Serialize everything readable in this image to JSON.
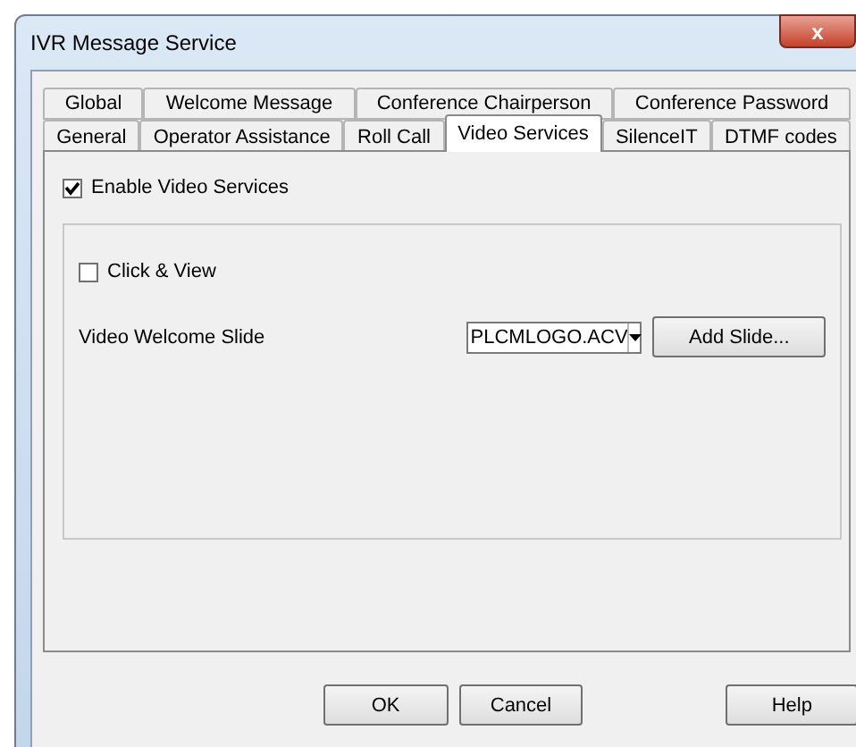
{
  "window": {
    "title": "IVR Message Service",
    "close": "x"
  },
  "tab_rows": [
    [
      {
        "label": "Global",
        "selected": false
      },
      {
        "label": "Welcome Message",
        "selected": false
      },
      {
        "label": "Conference Chairperson",
        "selected": false
      },
      {
        "label": "Conference Password",
        "selected": false
      }
    ],
    [
      {
        "label": "General",
        "selected": false
      },
      {
        "label": "Operator Assistance",
        "selected": false
      },
      {
        "label": "Roll Call",
        "selected": false
      },
      {
        "label": "Video Services",
        "selected": true
      },
      {
        "label": "SilenceIT",
        "selected": false
      },
      {
        "label": "DTMF codes",
        "selected": false
      }
    ]
  ],
  "enable_video": {
    "label": "Enable Video Services",
    "checked": true
  },
  "click_view": {
    "label": "Click & View",
    "checked": false
  },
  "welcome_slide": {
    "label": "Video Welcome Slide",
    "value": "PLCMLOGO.ACV",
    "button": "Add Slide..."
  },
  "buttons": [
    "OK",
    "Cancel",
    "Help"
  ]
}
